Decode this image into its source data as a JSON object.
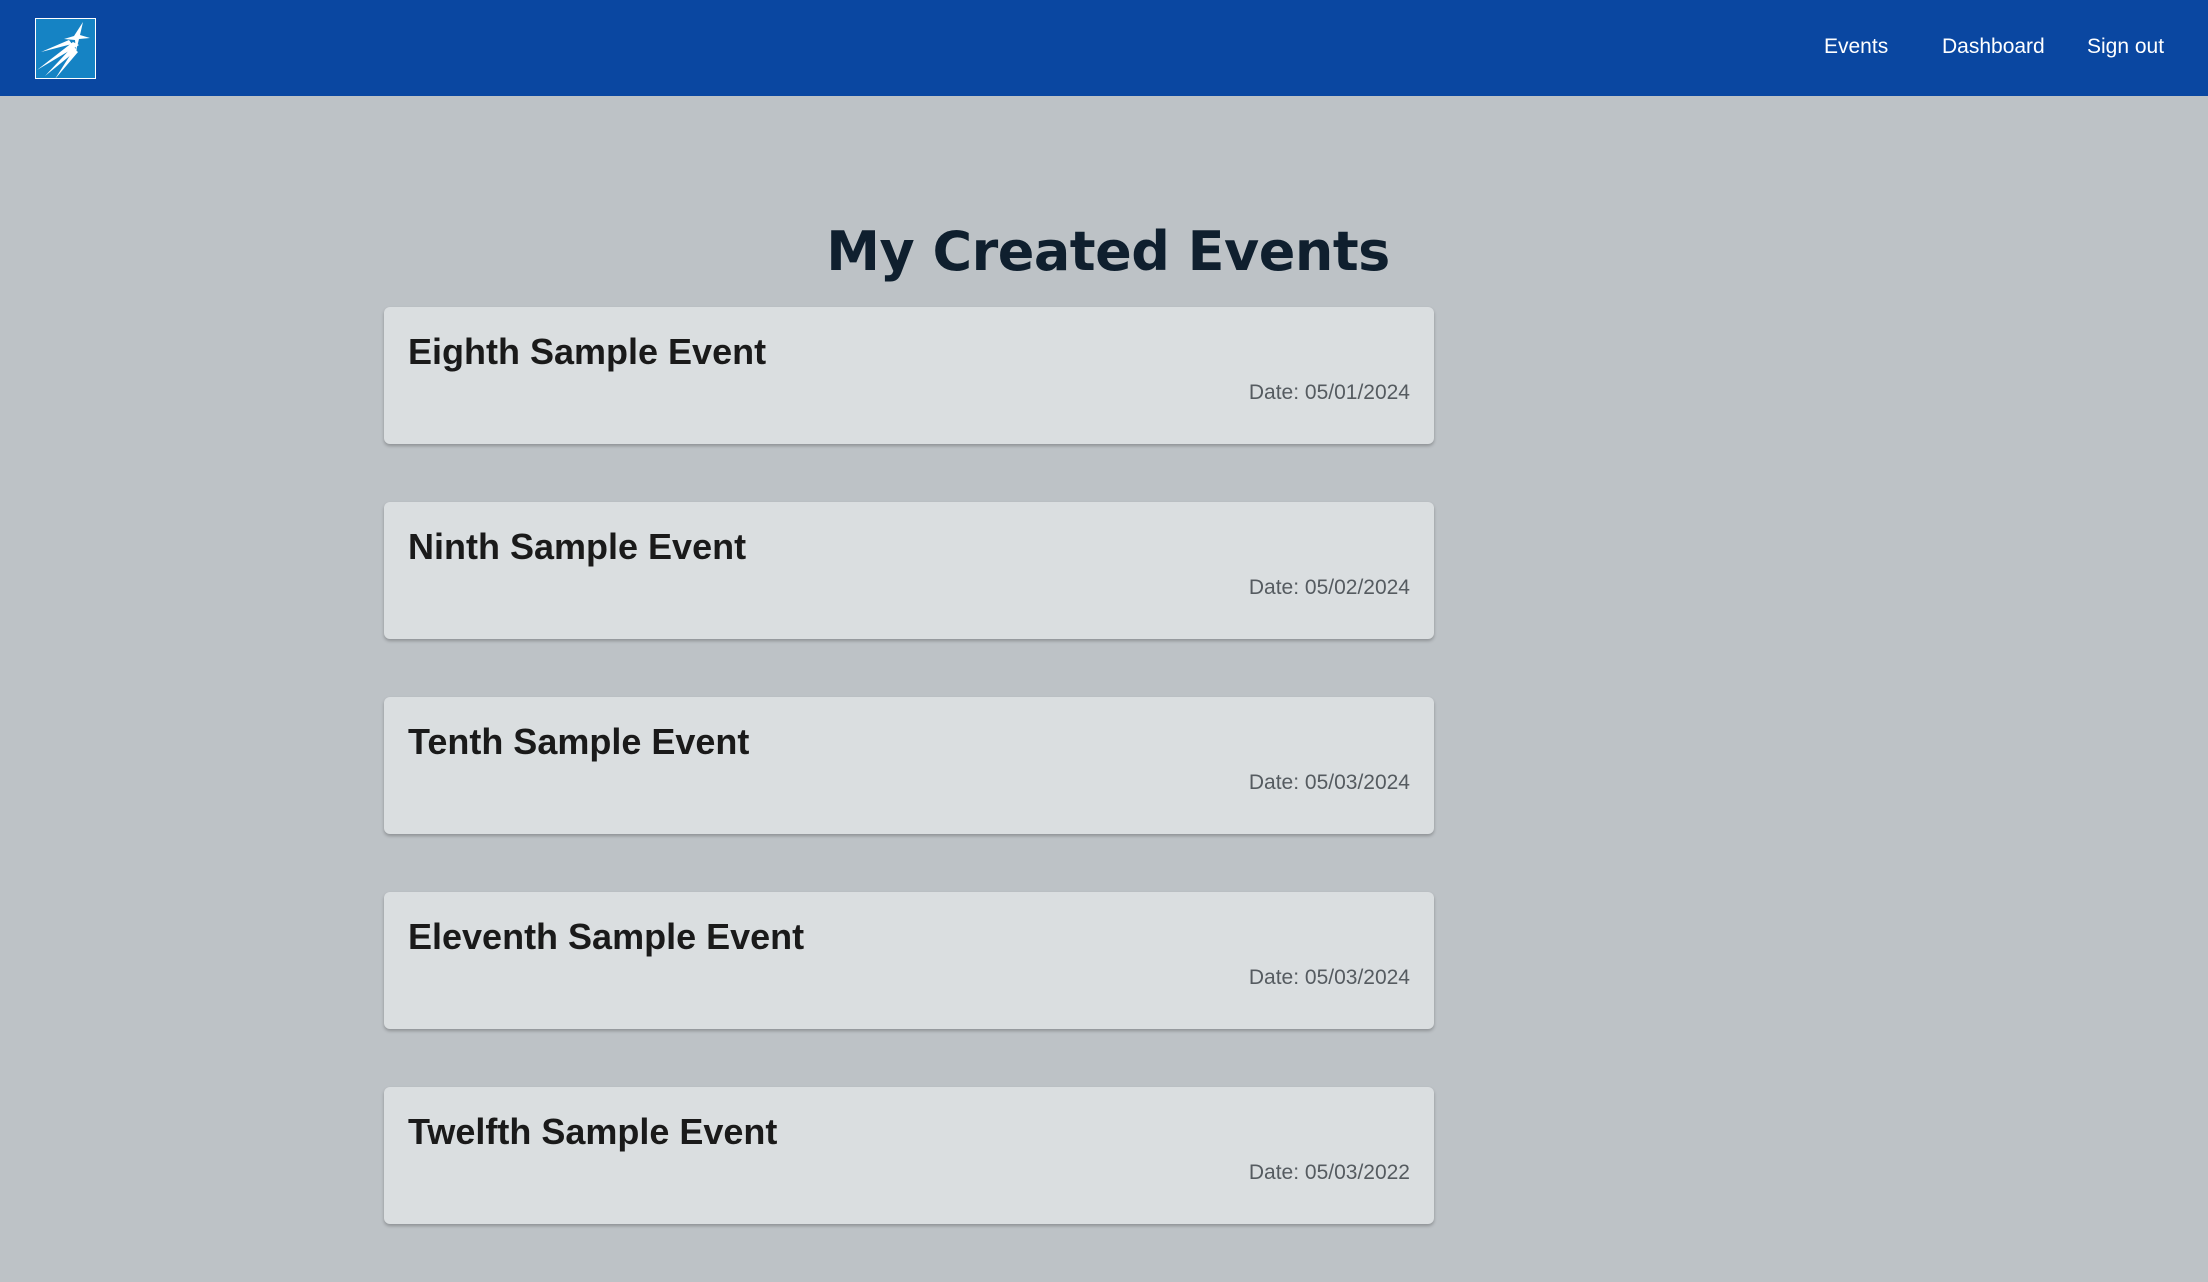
{
  "navbar": {
    "logo_icon": "starburst-logo-icon",
    "links": [
      {
        "label": "Events"
      },
      {
        "label": "Dashboard"
      },
      {
        "label": "Sign out"
      }
    ],
    "background_color": "#0a47a1"
  },
  "page": {
    "title": "My Created Events",
    "background_color": "#bdc2c6"
  },
  "events": [
    {
      "title": "Eighth Sample Event",
      "date": "Date: 05/01/2024"
    },
    {
      "title": "Ninth Sample Event",
      "date": "Date: 05/02/2024"
    },
    {
      "title": "Tenth Sample Event",
      "date": "Date: 05/03/2024"
    },
    {
      "title": "Eleventh Sample Event",
      "date": "Date: 05/03/2024"
    },
    {
      "title": "Twelfth Sample Event",
      "date": "Date: 05/03/2022"
    }
  ]
}
